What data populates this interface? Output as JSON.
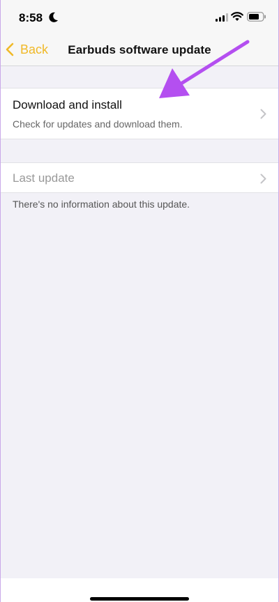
{
  "status_bar": {
    "time": "8:58",
    "icons": [
      "moon-icon",
      "cellular-signal-icon",
      "wifi-icon",
      "battery-icon"
    ]
  },
  "nav": {
    "back_label": "Back",
    "title": "Earbuds software update"
  },
  "sections": {
    "download": {
      "title": "Download and install",
      "subtitle": "Check for updates and download them."
    },
    "last_update": {
      "title": "Last update",
      "note": "There's no information about this update."
    }
  },
  "colors": {
    "accent": "#f0b928",
    "background": "#f2f1f7",
    "annotation_arrow": "#b44ff0"
  }
}
